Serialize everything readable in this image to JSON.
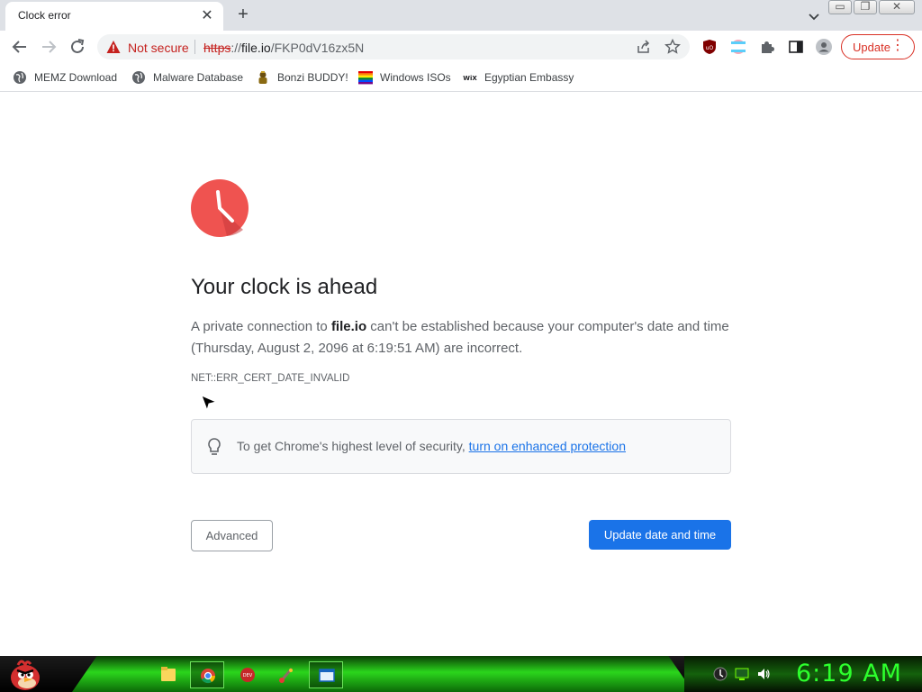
{
  "browser": {
    "tab": {
      "title": "Clock error"
    },
    "omnibox": {
      "security_label": "Not secure",
      "url_scheme": "https",
      "url_rest_prefix": "://",
      "url_host": "file.io",
      "url_path": "/FKP0dV16zx5N"
    },
    "update_button": "Update",
    "bookmarks": [
      {
        "label": "MEMZ Download",
        "icon": "globe-icon"
      },
      {
        "label": "Malware Database",
        "icon": "globe-icon"
      },
      {
        "label": "Bonzi BUDDY!",
        "icon": "bonzi-icon"
      },
      {
        "label": "Windows ISOs",
        "icon": "rainbow-icon"
      },
      {
        "label": "Egyptian Embassy",
        "icon": "wix-icon"
      }
    ]
  },
  "page": {
    "heading": "Your clock is ahead",
    "desc_prefix": "A private connection to ",
    "desc_host": "file.io",
    "desc_suffix": " can't be established because your computer's date and time (Thursday, August 2, 2096 at 6:19:51 AM) are incorrect.",
    "error_code": "NET::ERR_CERT_DATE_INVALID",
    "tip_text": "To get Chrome's highest level of security, ",
    "tip_link": "turn on enhanced protection",
    "advanced_button": "Advanced",
    "primary_button": "Update date and time"
  },
  "taskbar": {
    "clock": "6:19 AM"
  },
  "colors": {
    "accent": "#1a73e8",
    "danger": "#d93025",
    "clock_icon": "#ef5350",
    "taskbar_green": "#2dff2d"
  }
}
